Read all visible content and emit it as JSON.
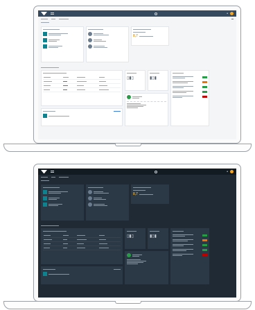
{
  "colors": {
    "shell_bar_light": "#354a5f",
    "shell_bar_dark": "#121a22",
    "tile_teal": "#0f828f",
    "kpi_gold": "#e6a21a",
    "status_green": "#2b9a48",
    "status_orange": "#e9730c",
    "status_red": "#bb0000",
    "dark_background": "#1f2a35"
  },
  "icons": [
    "sap-logo",
    "menu-icon",
    "search-icon",
    "bell-icon",
    "user-avatar",
    "bar-chart-icon",
    "plant-icon"
  ],
  "views": [
    {
      "theme": "light"
    },
    {
      "theme": "dark"
    }
  ],
  "kpi": {
    "value": "8,7"
  }
}
